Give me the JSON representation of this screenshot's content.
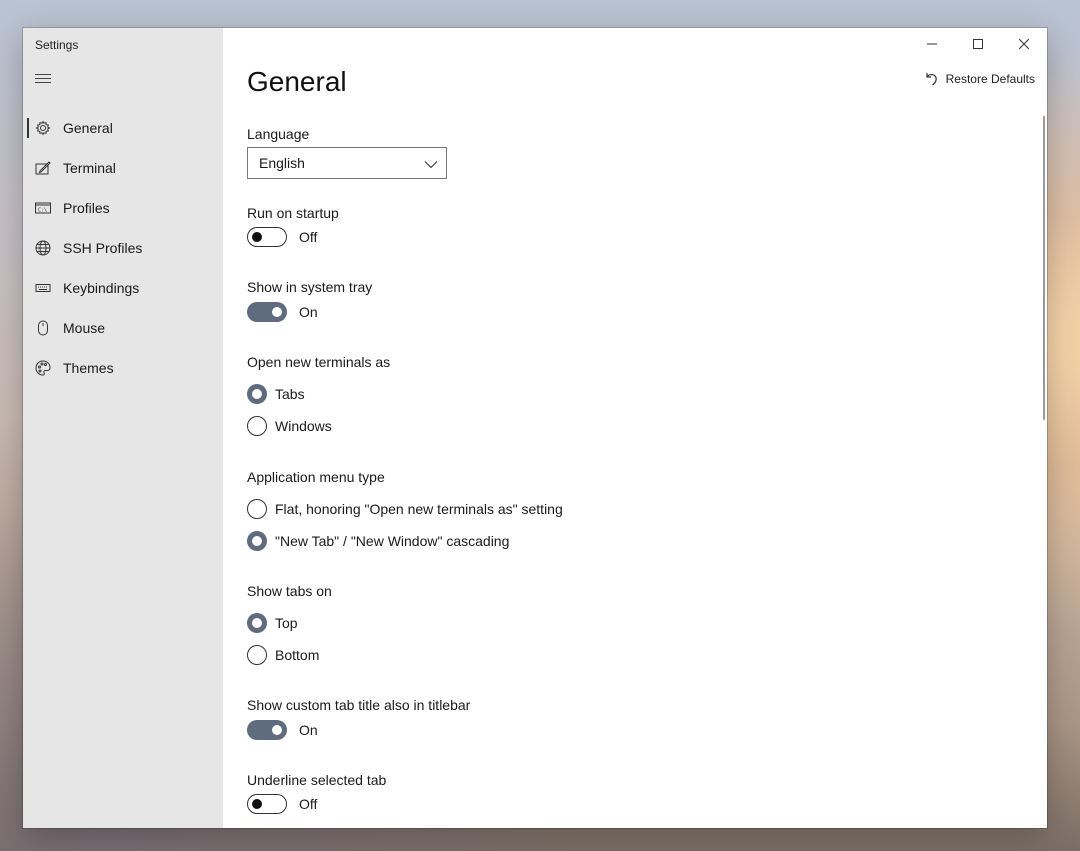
{
  "window": {
    "title": "Settings"
  },
  "sidebar": {
    "items": [
      {
        "label": "General",
        "icon": "gear-icon",
        "active": true
      },
      {
        "label": "Terminal",
        "icon": "terminal-pen-icon",
        "active": false
      },
      {
        "label": "Profiles",
        "icon": "command-prompt-icon",
        "active": false
      },
      {
        "label": "SSH Profiles",
        "icon": "globe-icon",
        "active": false
      },
      {
        "label": "Keybindings",
        "icon": "keyboard-icon",
        "active": false
      },
      {
        "label": "Mouse",
        "icon": "mouse-icon",
        "active": false
      },
      {
        "label": "Themes",
        "icon": "palette-icon",
        "active": false
      }
    ]
  },
  "header": {
    "title": "General",
    "restore_label": "Restore Defaults"
  },
  "settings": {
    "language": {
      "label": "Language",
      "value": "English"
    },
    "run_on_startup": {
      "label": "Run on startup",
      "state": "Off"
    },
    "system_tray": {
      "label": "Show in system tray",
      "state": "On"
    },
    "open_new_terminals": {
      "label": "Open new terminals as",
      "options": [
        "Tabs",
        "Windows"
      ],
      "selected": "Tabs"
    },
    "app_menu_type": {
      "label": "Application menu type",
      "options": [
        "Flat, honoring \"Open new terminals as\" setting",
        "\"New Tab\" / \"New Window\" cascading"
      ],
      "selected": "\"New Tab\" / \"New Window\" cascading"
    },
    "show_tabs_on": {
      "label": "Show tabs on",
      "options": [
        "Top",
        "Bottom"
      ],
      "selected": "Top"
    },
    "custom_title_titlebar": {
      "label": "Show custom tab title also in titlebar",
      "state": "On"
    },
    "underline_selected_tab": {
      "label": "Underline selected tab",
      "state": "Off"
    }
  },
  "colors": {
    "accent": "#5f6b7e",
    "sidebar_bg": "#e6e6e6",
    "content_bg": "#ffffff"
  }
}
